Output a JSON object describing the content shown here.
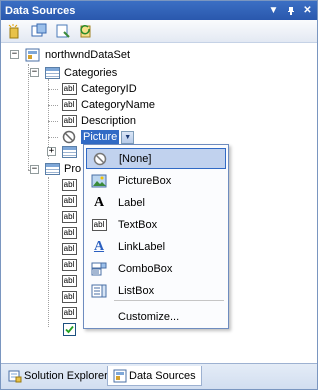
{
  "window": {
    "title": "Data Sources"
  },
  "tree": {
    "dataset": "northwndDataSet",
    "categories": {
      "label": "Categories",
      "fields": [
        "CategoryID",
        "CategoryName",
        "Description"
      ],
      "editing_field": "Picture"
    },
    "products": {
      "label": "Pro"
    }
  },
  "dropdown": {
    "items": [
      {
        "label": "[None]",
        "icon": "none-icon"
      },
      {
        "label": "PictureBox",
        "icon": "picturebox-icon"
      },
      {
        "label": "Label",
        "icon": "label-icon"
      },
      {
        "label": "TextBox",
        "icon": "textbox-icon"
      },
      {
        "label": "LinkLabel",
        "icon": "linklabel-icon"
      },
      {
        "label": "ComboBox",
        "icon": "combobox-icon"
      },
      {
        "label": "ListBox",
        "icon": "listbox-icon"
      }
    ],
    "customize": "Customize..."
  },
  "tabs": [
    {
      "label": "Solution Explorer"
    },
    {
      "label": "Data Sources"
    }
  ],
  "colors": {
    "title_bar": "#2a58ad",
    "selection": "#316ac5",
    "dropdown_highlight": "#c1d2ee"
  }
}
